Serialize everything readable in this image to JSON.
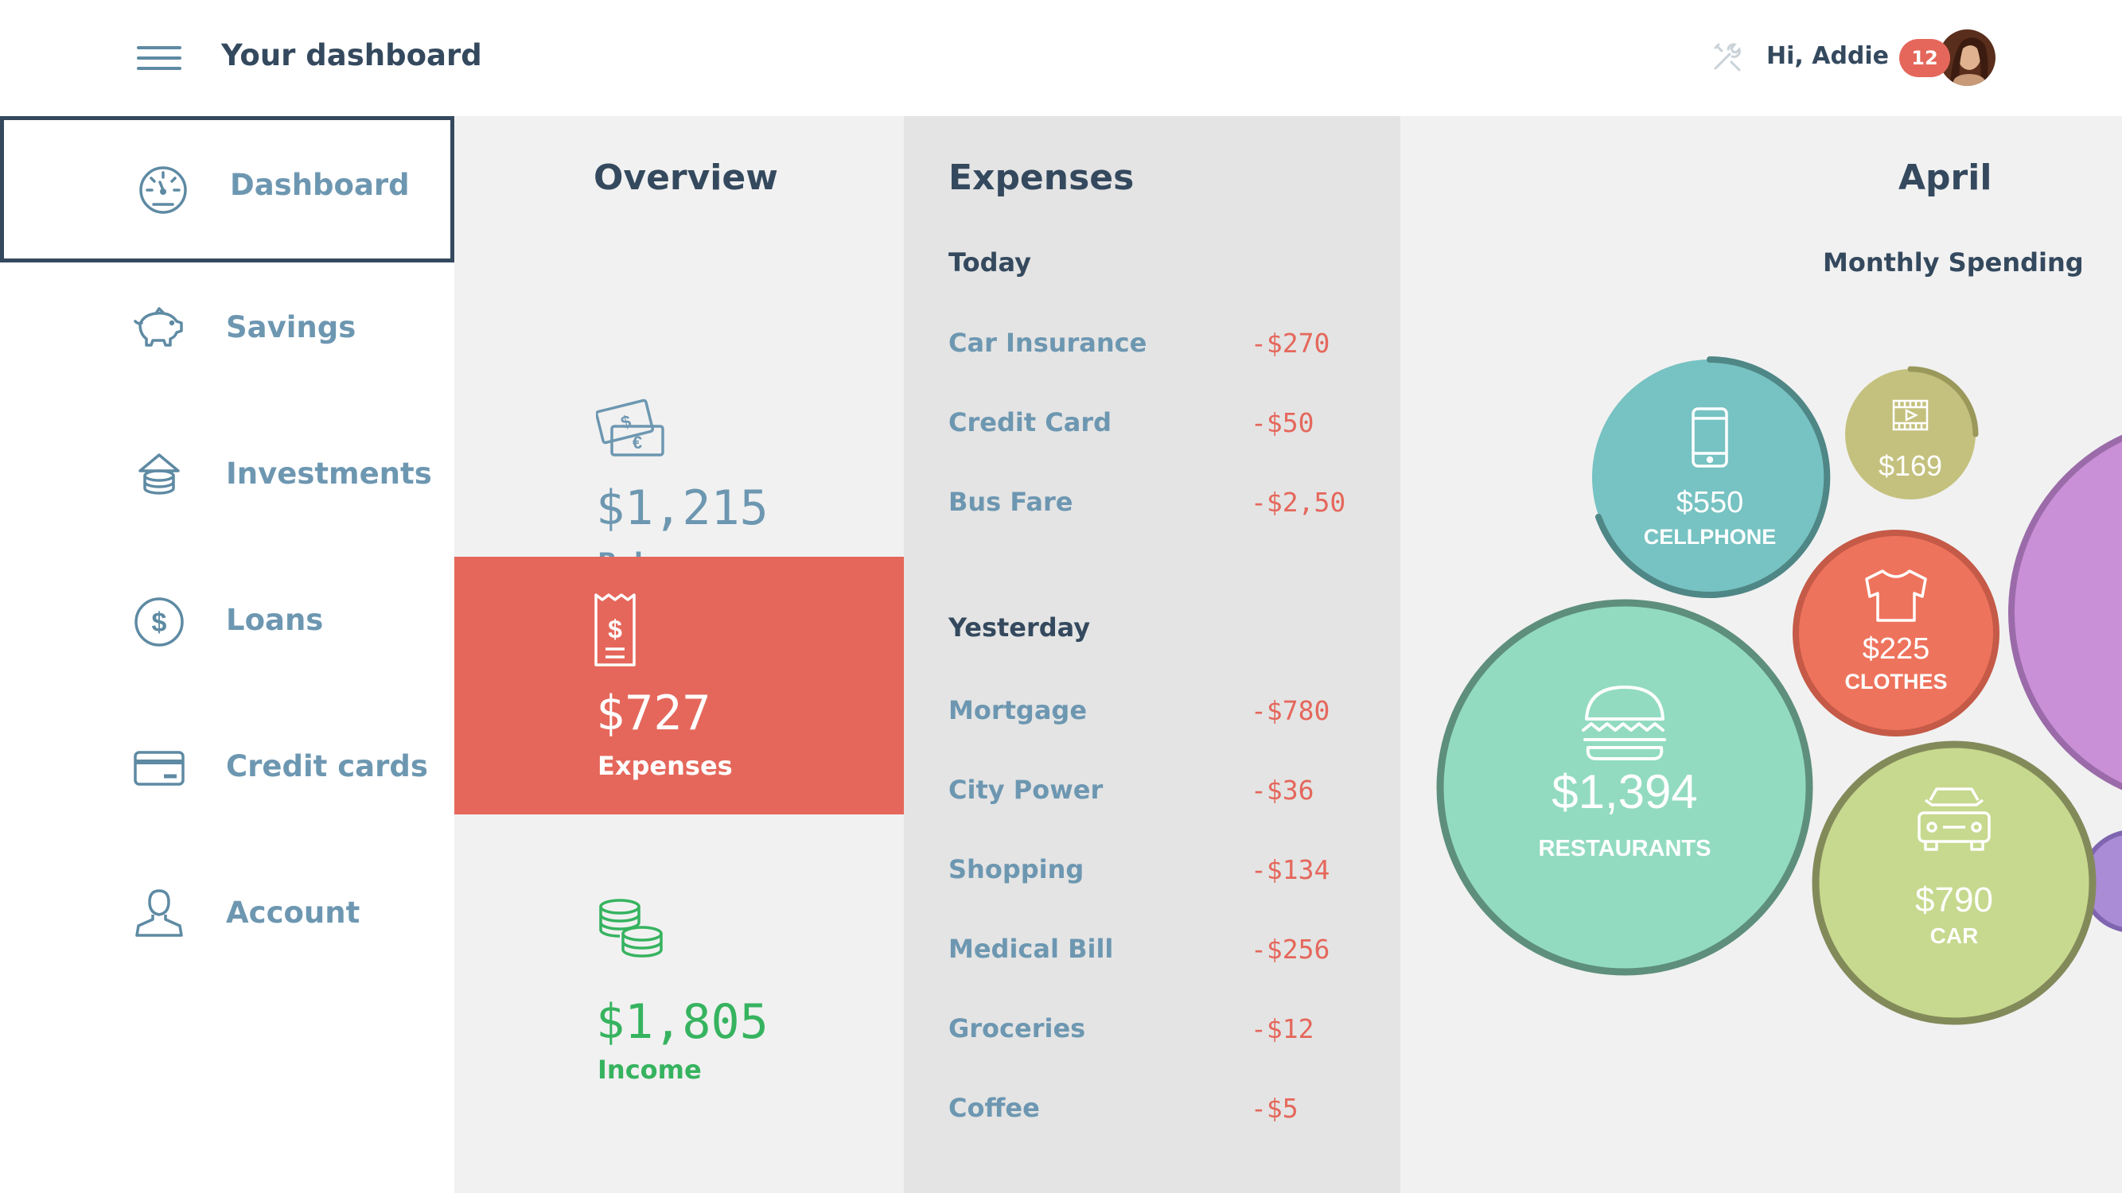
{
  "header": {
    "title": "Your dashboard",
    "greeting": "Hi, Addie",
    "notifications": "12"
  },
  "sidebar": {
    "items": [
      {
        "label": "Dashboard",
        "icon": "speedometer-icon",
        "active": true
      },
      {
        "label": "Savings",
        "icon": "piggy-bank-icon"
      },
      {
        "label": "Investments",
        "icon": "coin-stack-house-icon"
      },
      {
        "label": "Loans",
        "icon": "dollar-circle-icon"
      },
      {
        "label": "Credit cards",
        "icon": "credit-card-icon"
      },
      {
        "label": "Account",
        "icon": "user-icon"
      }
    ]
  },
  "overview": {
    "title": "Overview",
    "balance": {
      "amount": "$1,215",
      "label": "Balance",
      "icon": "banknotes-icon"
    },
    "expenses": {
      "amount": "$727",
      "label": "Expenses",
      "icon": "receipt-icon"
    },
    "income": {
      "amount": "$1,805",
      "label": "Income",
      "icon": "coins-icon"
    }
  },
  "expenses": {
    "title": "Expenses",
    "today": {
      "label": "Today",
      "items": [
        {
          "name": "Car Insurance",
          "amount": "-$270"
        },
        {
          "name": "Credit Card",
          "amount": "-$50"
        },
        {
          "name": "Bus Fare",
          "amount": "-$2,50"
        }
      ]
    },
    "yesterday": {
      "label": "Yesterday",
      "items": [
        {
          "name": "Mortgage",
          "amount": "-$780"
        },
        {
          "name": "City Power",
          "amount": "-$36"
        },
        {
          "name": "Shopping",
          "amount": "-$134"
        },
        {
          "name": "Medical Bill",
          "amount": "-$256"
        },
        {
          "name": "Groceries",
          "amount": "-$12"
        },
        {
          "name": "Coffee",
          "amount": "-$5"
        }
      ]
    }
  },
  "april": {
    "title": "April",
    "subtitle": "Monthly Spending"
  },
  "chart_data": {
    "type": "bubble",
    "title": "Monthly Spending",
    "series": [
      {
        "category": "CELLPHONE",
        "value": 550,
        "label": "$550",
        "icon": "phone-icon",
        "color": "#77c2c2"
      },
      {
        "category": "",
        "value": 169,
        "label": "$169",
        "icon": "film-icon",
        "color": "#c4c17e"
      },
      {
        "category": "CLOTHES",
        "value": 225,
        "label": "$225",
        "icon": "shirt-icon",
        "color": "#ee735c"
      },
      {
        "category": "RESTAURANTS",
        "value": 1394,
        "label": "$1,394",
        "icon": "burger-icon",
        "color": "#92dbc1"
      },
      {
        "category": "CAR",
        "value": 790,
        "label": "$790",
        "icon": "car-icon",
        "color": "#c6d98e"
      }
    ]
  },
  "colors": {
    "accent_red": "#e5675b",
    "income_green": "#36b35f",
    "label_blue": "#6d97b1",
    "dark_text": "#34495e"
  }
}
